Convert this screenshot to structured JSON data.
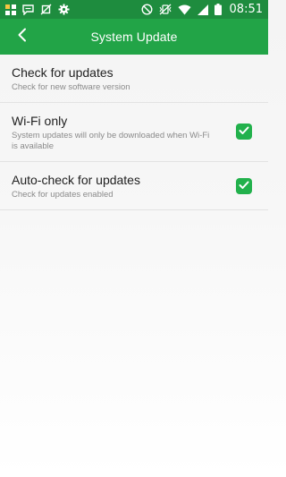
{
  "status_bar": {
    "time": "08:51",
    "left_icons": [
      "apps-grid-icon",
      "chat-bubble-icon",
      "no-location-icon",
      "gear-icon"
    ],
    "right_icons": [
      "do-not-disturb-icon",
      "vibrate-off-icon",
      "wifi-icon",
      "signal-icon",
      "battery-icon"
    ]
  },
  "app_bar": {
    "title": "System Update",
    "back_icon": "chevron-left-icon"
  },
  "settings": [
    {
      "title": "Check for updates",
      "subtitle": "Check for new software version"
    },
    {
      "title": "Wi-Fi only",
      "subtitle": "System updates will only be downloaded when Wi-Fi is available",
      "checked": true
    },
    {
      "title": "Auto-check for updates",
      "subtitle": "Check for updates enabled",
      "checked": true
    }
  ],
  "colors": {
    "status_bar": "#1e8c3e",
    "app_bar": "#22a447",
    "checkbox": "#22b14c"
  }
}
